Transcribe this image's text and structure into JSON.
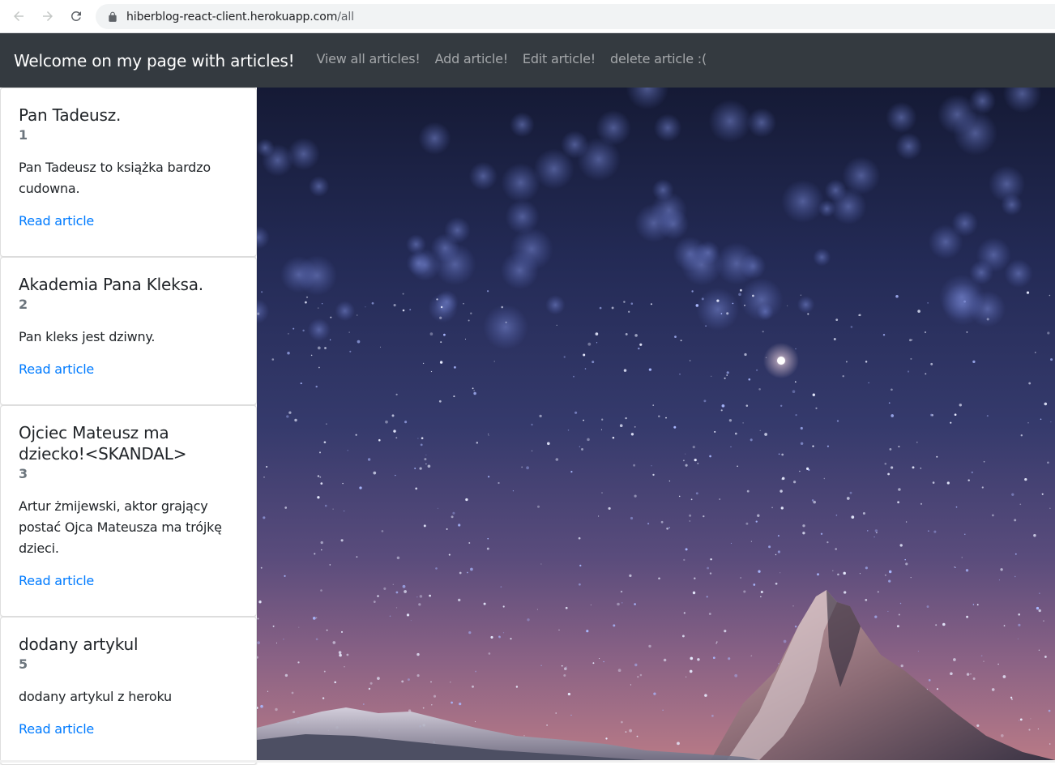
{
  "browser": {
    "url_host": "hiberblog-react-client.herokuapp.com",
    "url_path": "/all"
  },
  "navbar": {
    "brand": "Welcome on my page with articles!",
    "links": [
      {
        "label": "View all articles!"
      },
      {
        "label": "Add article!"
      },
      {
        "label": "Edit article!"
      },
      {
        "label": "delete article :("
      }
    ]
  },
  "articles": [
    {
      "title": "Pan Tadeusz.",
      "id": "1",
      "text": "Pan Tadeusz to książka bardzo cudowna.",
      "link": "Read article"
    },
    {
      "title": "Akademia Pana Kleksa.",
      "id": "2",
      "text": "Pan kleks jest dziwny.",
      "link": "Read article"
    },
    {
      "title": "Ojciec Mateusz ma dziecko!<SKANDAL>",
      "id": "3",
      "text": "Artur żmijewski, aktor grający postać Ojca Mateusza ma trójkę dzieci.",
      "link": "Read article"
    },
    {
      "title": "dodany artykul",
      "id": "5",
      "text": "dodany artykul z heroku",
      "link": "Read article"
    }
  ],
  "icons": {
    "back": "arrow-left-icon",
    "forward": "arrow-right-icon",
    "reload": "reload-icon",
    "lock": "lock-icon"
  },
  "colors": {
    "navbar_bg": "#343a40",
    "link": "#007bff"
  }
}
